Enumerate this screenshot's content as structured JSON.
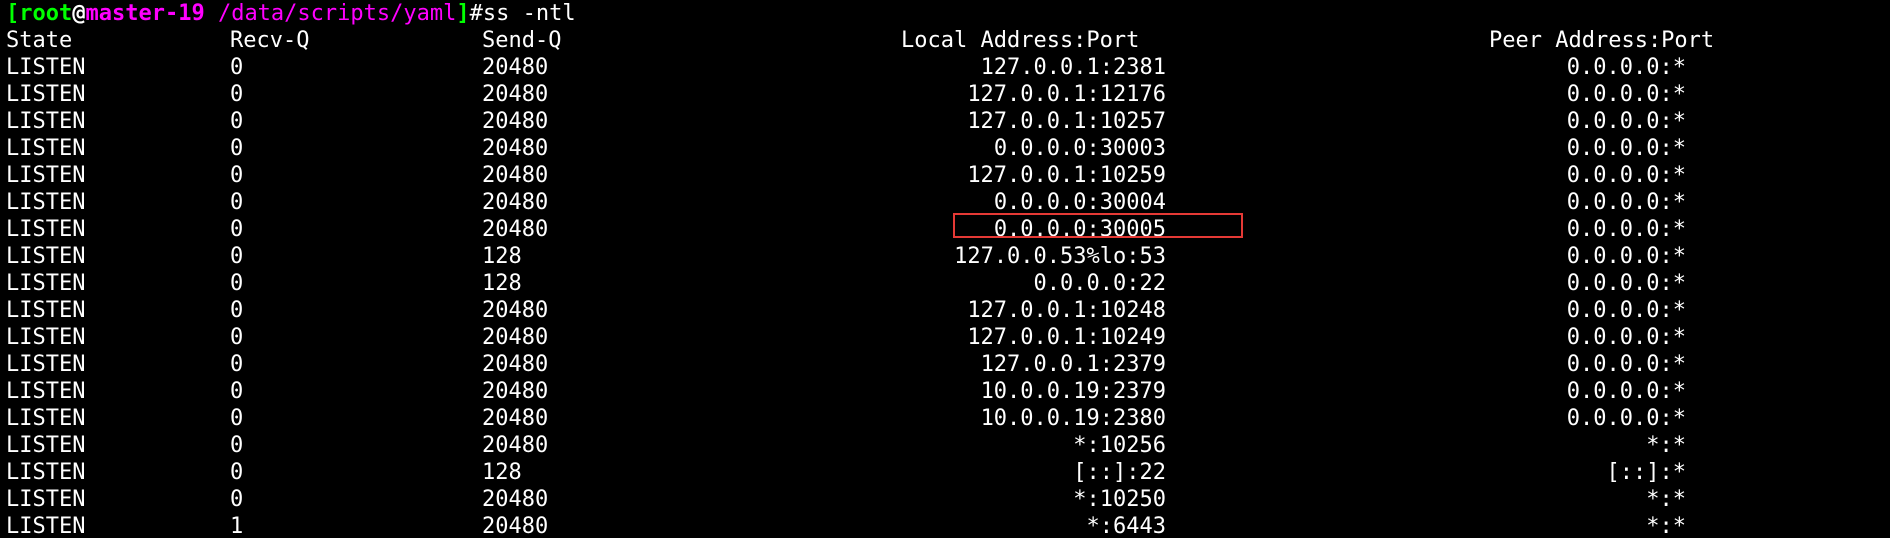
{
  "prompt": {
    "open_bracket": "[",
    "user": "root",
    "at": "@",
    "host": "master-19",
    "path": " /data/scripts/yaml",
    "close_bracket": "]",
    "symbol": "#",
    "command": "ss -ntl"
  },
  "table": {
    "headers": {
      "state": "State",
      "recv_q": "Recv-Q",
      "send_q": "Send-Q",
      "local": "Local Address:Port",
      "peer": "Peer Address:Port"
    },
    "rows": [
      {
        "state": "LISTEN",
        "recv_q": "0",
        "send_q": "20480",
        "local": "127.0.0.1:2381",
        "peer": "0.0.0.0:*"
      },
      {
        "state": "LISTEN",
        "recv_q": "0",
        "send_q": "20480",
        "local": "127.0.0.1:12176",
        "peer": "0.0.0.0:*"
      },
      {
        "state": "LISTEN",
        "recv_q": "0",
        "send_q": "20480",
        "local": "127.0.0.1:10257",
        "peer": "0.0.0.0:*"
      },
      {
        "state": "LISTEN",
        "recv_q": "0",
        "send_q": "20480",
        "local": "0.0.0.0:30003",
        "peer": "0.0.0.0:*"
      },
      {
        "state": "LISTEN",
        "recv_q": "0",
        "send_q": "20480",
        "local": "127.0.0.1:10259",
        "peer": "0.0.0.0:*"
      },
      {
        "state": "LISTEN",
        "recv_q": "0",
        "send_q": "20480",
        "local": "0.0.0.0:30004",
        "peer": "0.0.0.0:*"
      },
      {
        "state": "LISTEN",
        "recv_q": "0",
        "send_q": "20480",
        "local": "0.0.0.0:30005",
        "peer": "0.0.0.0:*"
      },
      {
        "state": "LISTEN",
        "recv_q": "0",
        "send_q": "128",
        "local": "127.0.0.53%lo:53",
        "peer": "0.0.0.0:*"
      },
      {
        "state": "LISTEN",
        "recv_q": "0",
        "send_q": "128",
        "local": "0.0.0.0:22",
        "peer": "0.0.0.0:*"
      },
      {
        "state": "LISTEN",
        "recv_q": "0",
        "send_q": "20480",
        "local": "127.0.0.1:10248",
        "peer": "0.0.0.0:*"
      },
      {
        "state": "LISTEN",
        "recv_q": "0",
        "send_q": "20480",
        "local": "127.0.0.1:10249",
        "peer": "0.0.0.0:*"
      },
      {
        "state": "LISTEN",
        "recv_q": "0",
        "send_q": "20480",
        "local": "127.0.0.1:2379",
        "peer": "0.0.0.0:*"
      },
      {
        "state": "LISTEN",
        "recv_q": "0",
        "send_q": "20480",
        "local": "10.0.0.19:2379",
        "peer": "0.0.0.0:*"
      },
      {
        "state": "LISTEN",
        "recv_q": "0",
        "send_q": "20480",
        "local": "10.0.0.19:2380",
        "peer": "0.0.0.0:*"
      },
      {
        "state": "LISTEN",
        "recv_q": "0",
        "send_q": "20480",
        "local": "*:10256",
        "peer": "*:*"
      },
      {
        "state": "LISTEN",
        "recv_q": "0",
        "send_q": "128",
        "local": "[::]:22",
        "peer": "[::]:*"
      },
      {
        "state": "LISTEN",
        "recv_q": "0",
        "send_q": "20480",
        "local": "*:10250",
        "peer": "*:*"
      },
      {
        "state": "LISTEN",
        "recv_q": "1",
        "send_q": "20480",
        "local": "*:6443",
        "peer": "*:*"
      }
    ]
  },
  "highlight_color": "#e53935"
}
